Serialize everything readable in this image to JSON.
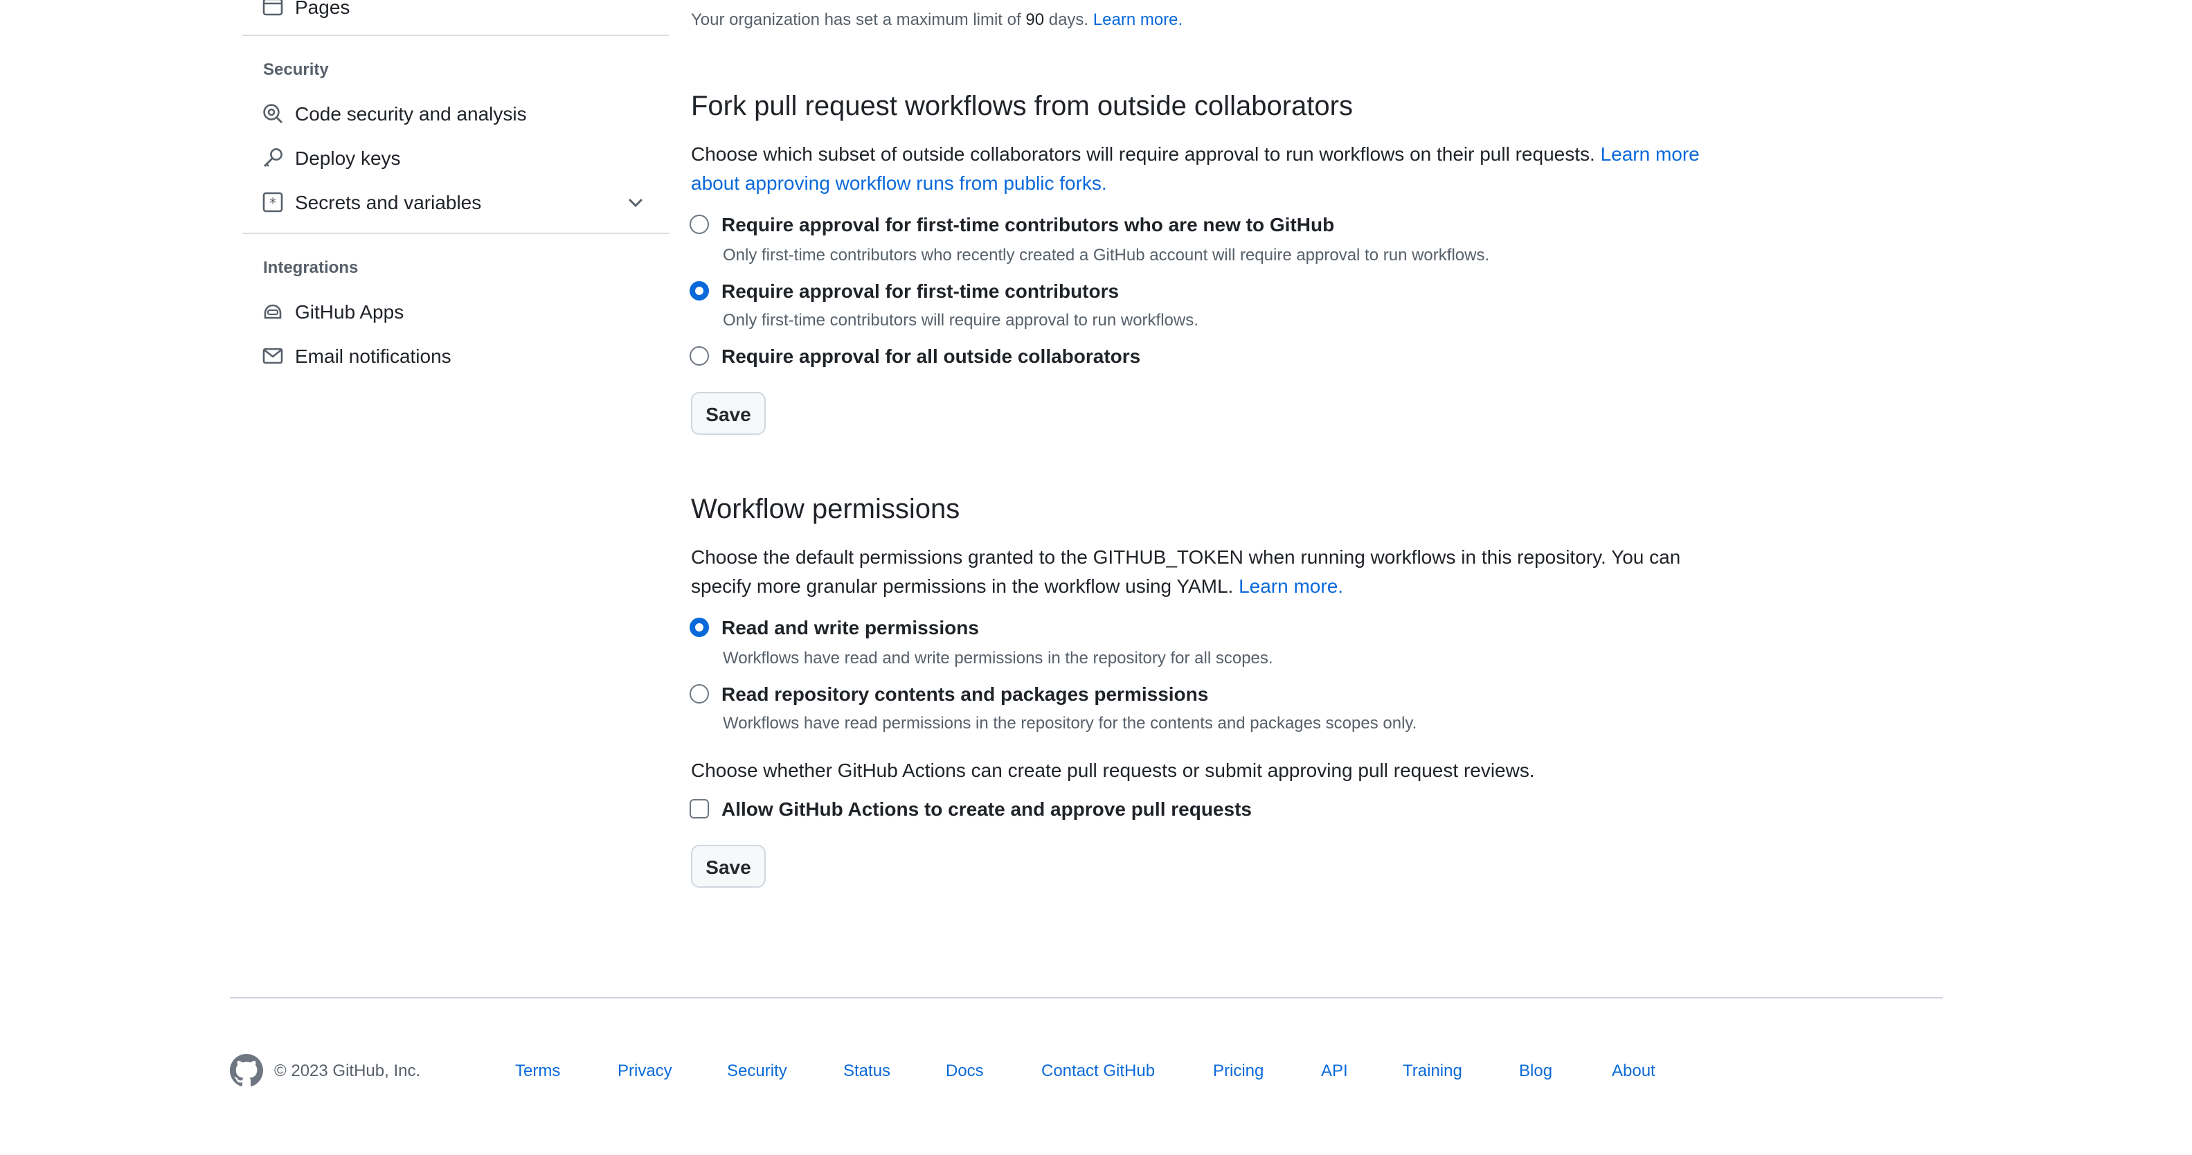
{
  "sidebar": {
    "pages_label": "Pages",
    "security_heading": "Security",
    "security_items": [
      {
        "label": "Code security and analysis",
        "icon": "shield-search-icon"
      },
      {
        "label": "Deploy keys",
        "icon": "key-icon"
      },
      {
        "label": "Secrets and variables",
        "icon": "asterisk-box-icon"
      }
    ],
    "integrations_heading": "Integrations",
    "integration_items": [
      {
        "label": "GitHub Apps",
        "icon": "app-robot-icon"
      },
      {
        "label": "Email notifications",
        "icon": "mail-icon"
      }
    ]
  },
  "retention": {
    "text_pre": "Your organization has set a maximum limit of ",
    "limit": "90",
    "text_post": " days.",
    "learn_more": "Learn more."
  },
  "fork_section": {
    "title": "Fork pull request workflows from outside collaborators",
    "description": "Choose which subset of outside collaborators will require approval to run workflows on their pull requests.",
    "learn_more": "Learn more about approving workflow runs from public forks.",
    "options": [
      {
        "label": "Require approval for first-time contributors who are new to GitHub",
        "note": "Only first-time contributors who recently created a GitHub account will require approval to run workflows.",
        "checked": false
      },
      {
        "label": "Require approval for first-time contributors",
        "note": "Only first-time contributors will require approval to run workflows.",
        "checked": true
      },
      {
        "label": "Require approval for all outside collaborators",
        "note": "",
        "checked": false
      }
    ],
    "save_label": "Save"
  },
  "workflow_permissions": {
    "title": "Workflow permissions",
    "description": "Choose the default permissions granted to the GITHUB_TOKEN when running workflows in this repository. You can specify more granular permissions in the workflow using YAML.",
    "learn_more": "Learn more.",
    "options": [
      {
        "label": "Read and write permissions",
        "note": "Workflows have read and write permissions in the repository for all scopes.",
        "checked": true
      },
      {
        "label": "Read repository contents and packages permissions",
        "note": "Workflows have read permissions in the repository for the contents and packages scopes only.",
        "checked": false
      }
    ],
    "pr_text": "Choose whether GitHub Actions can create pull requests or submit approving pull request reviews.",
    "checkbox_label": "Allow GitHub Actions to create and approve pull requests",
    "checkbox_checked": false,
    "save_label": "Save"
  },
  "footer": {
    "copyright": "© 2023 GitHub, Inc.",
    "links": [
      "Terms",
      "Privacy",
      "Security",
      "Status",
      "Docs",
      "Contact GitHub",
      "Pricing",
      "API",
      "Training",
      "Blog",
      "About"
    ]
  },
  "colors": {
    "accent": "#0969da",
    "text": "#1f2328",
    "muted": "#57606a",
    "border": "#d0d7de"
  }
}
